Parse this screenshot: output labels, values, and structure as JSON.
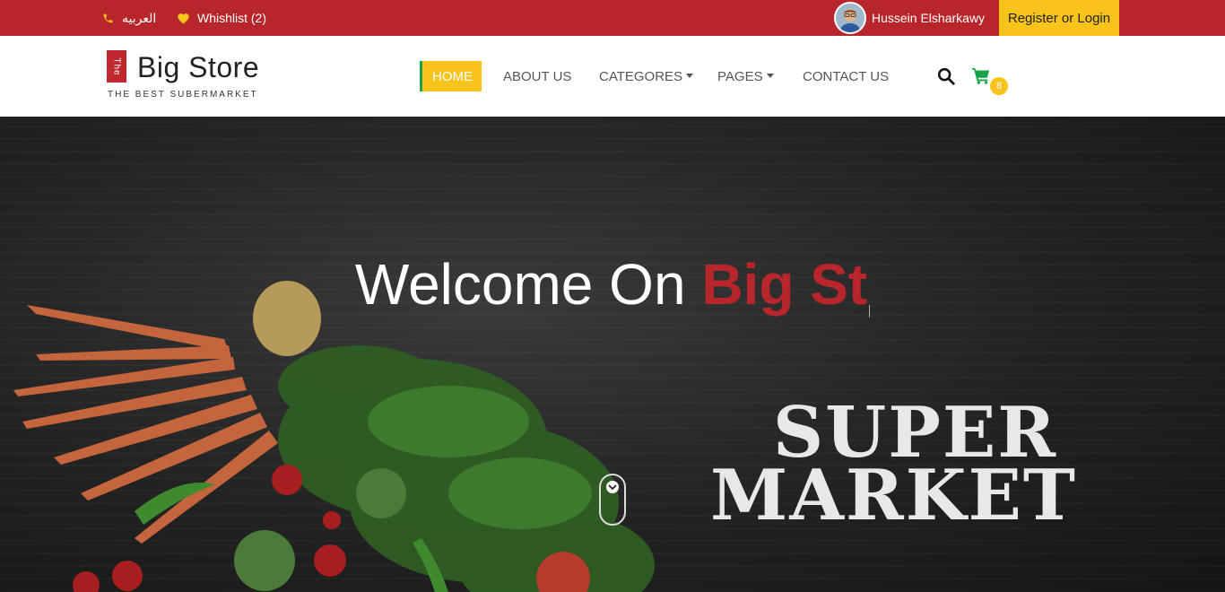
{
  "topbar": {
    "language_label": "العربيه",
    "wishlist_label": "Whishlist (2)",
    "user_name": "Hussein Elsharkawy",
    "auth_label": "Register or Login"
  },
  "brand": {
    "tag": "The",
    "name": "Big Store",
    "tagline": "THE BEST SUBERMARKET"
  },
  "nav": {
    "items": [
      {
        "label": "HOME"
      },
      {
        "label": "ABOUT US"
      },
      {
        "label": "CATEGORES"
      },
      {
        "label": "PAGES"
      },
      {
        "label": "CONTACT US"
      }
    ]
  },
  "cart": {
    "count": "8"
  },
  "hero": {
    "welcome_prefix": "Welcome On ",
    "welcome_highlight": "Big St",
    "sign_line1": "SUPER",
    "sign_line2": "MARKET"
  },
  "colors": {
    "topbar": "#b8262b",
    "accent_yellow": "#f8c41b",
    "cart_green": "#16a34a"
  },
  "icons": {
    "phone": "phone-icon",
    "heart": "heart-icon",
    "search": "search-icon",
    "cart": "cart-icon",
    "scroll_down": "chevron-down-icon"
  }
}
